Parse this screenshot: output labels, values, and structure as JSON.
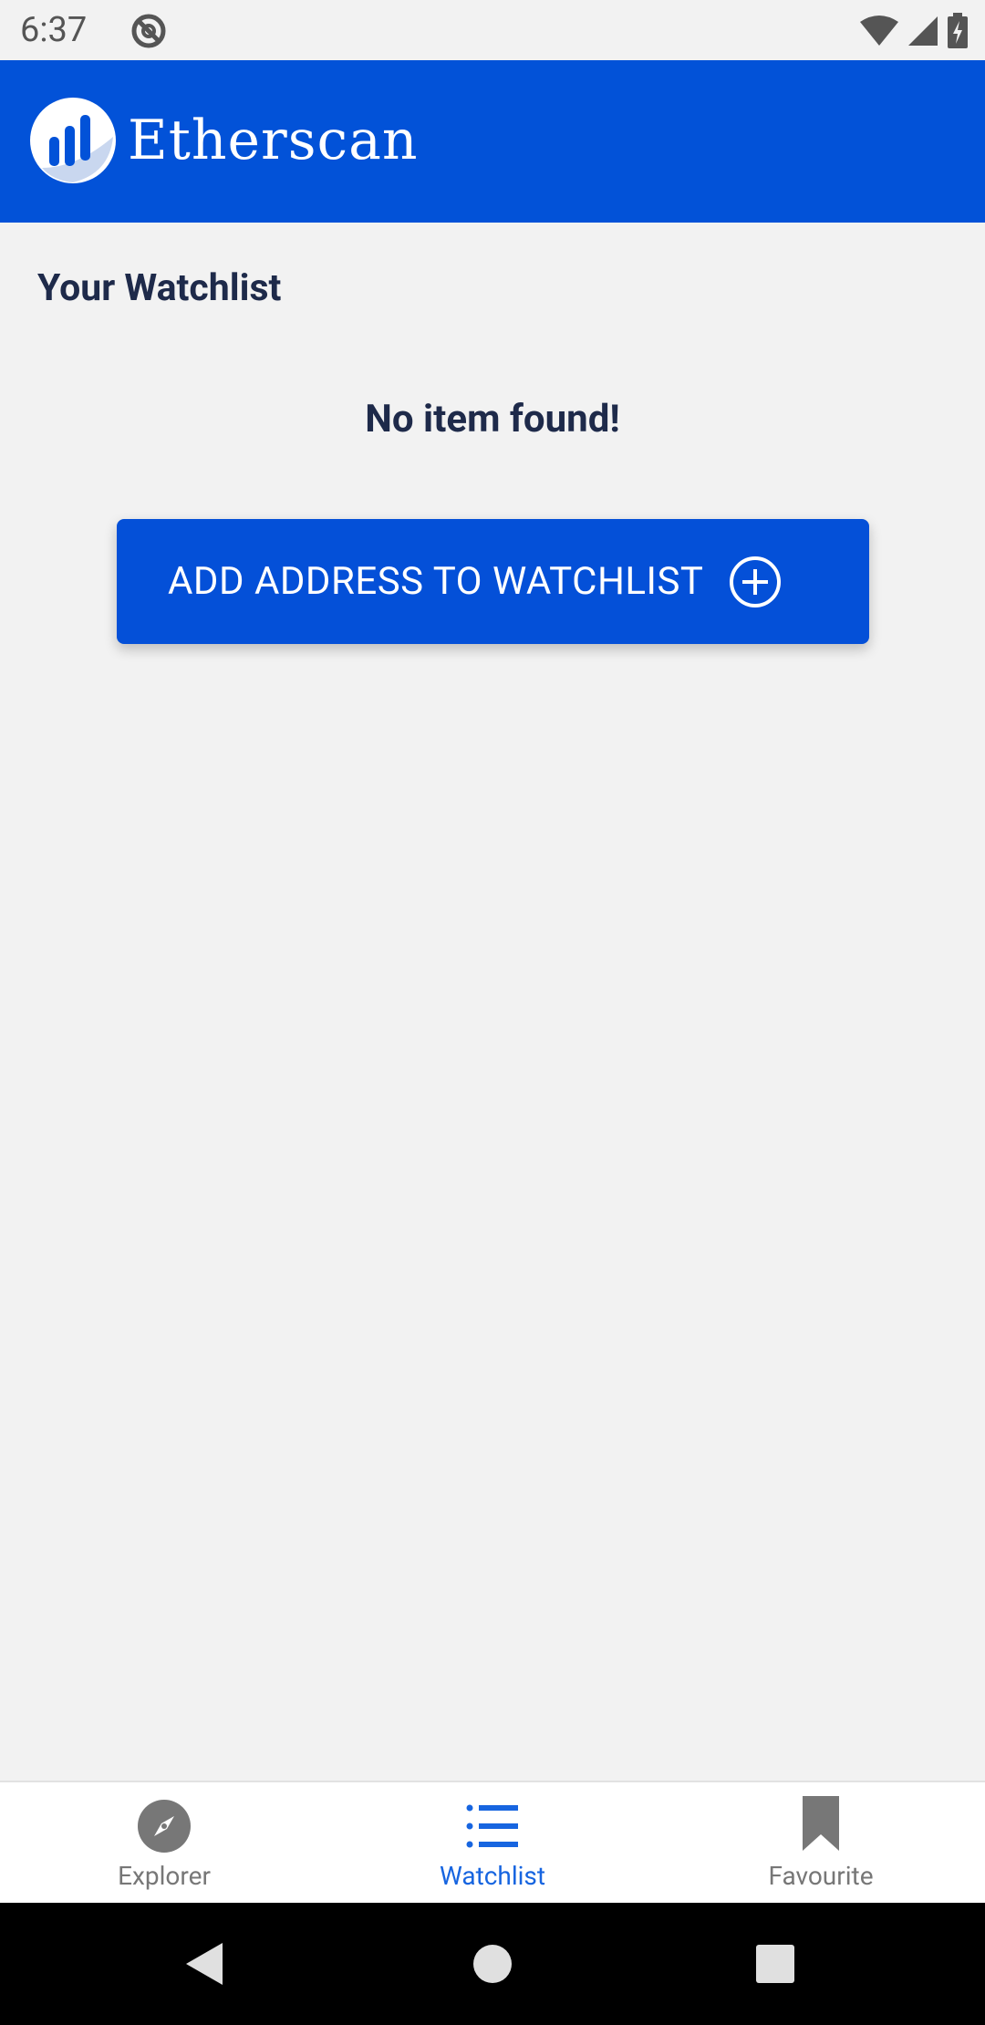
{
  "status_bar": {
    "time": "6:37"
  },
  "header": {
    "app_name": "Etherscan"
  },
  "watchlist": {
    "title": "Your Watchlist",
    "empty_message": "No item found!",
    "add_button_label": "ADD ADDRESS TO WATCHLIST"
  },
  "bottom_nav": {
    "items": [
      {
        "label": "Explorer",
        "icon": "compass-icon",
        "active": false
      },
      {
        "label": "Watchlist",
        "icon": "list-icon",
        "active": true
      },
      {
        "label": "Favourite",
        "icon": "bookmark-icon",
        "active": false
      }
    ]
  },
  "colors": {
    "brand_blue": "#0252d8",
    "button_blue": "#0450d8",
    "active_nav": "#1765e0",
    "inactive_nav": "#777777",
    "text_dark": "#1e2a4a",
    "background": "#f2f2f2"
  }
}
